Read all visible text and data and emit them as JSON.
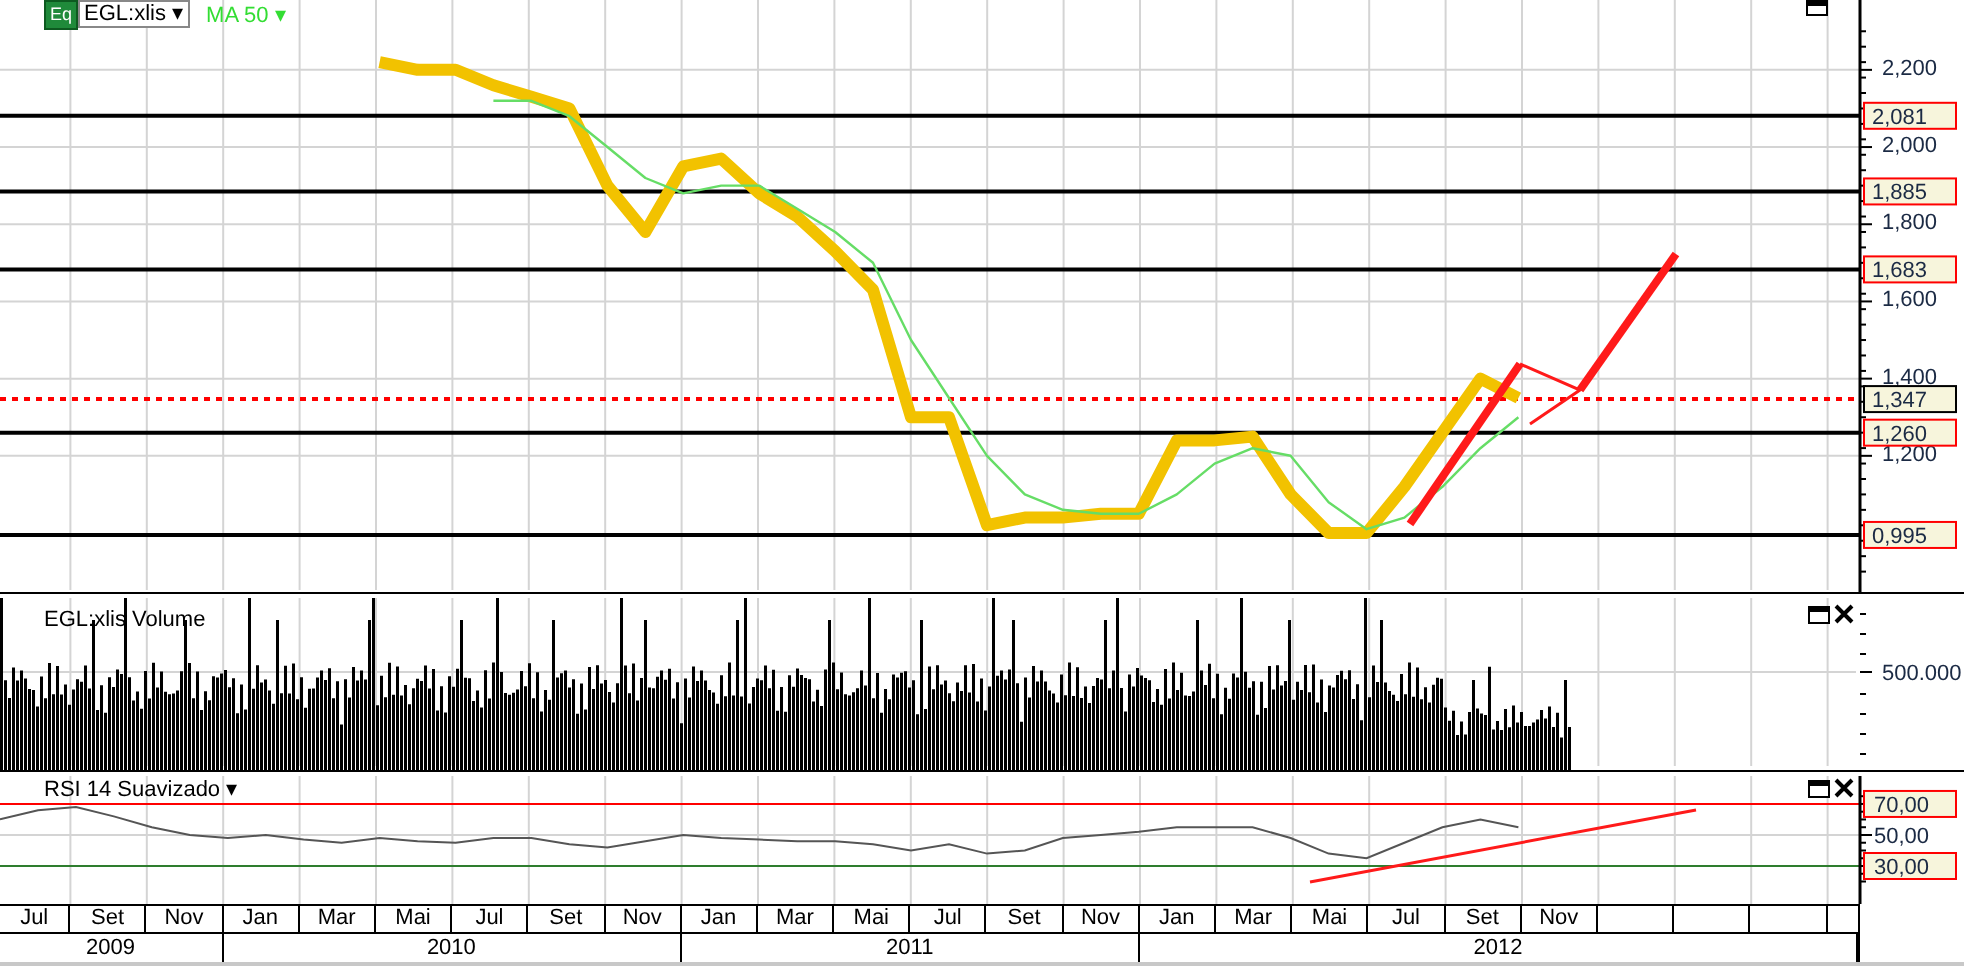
{
  "header": {
    "symbol_badge": "Eq",
    "symbol_caret": "▾",
    "indicator_caret": "▾"
  },
  "price_panel": {
    "chart_data": {
      "type": "line",
      "series": [
        {
          "name": "EGL:xlis",
          "color": "#f2c200",
          "values": [
            null,
            null,
            null,
            null,
            null,
            null,
            null,
            null,
            null,
            null,
            2.22,
            2.2,
            2.2,
            2.16,
            2.13,
            2.1,
            1.9,
            1.78,
            1.95,
            1.97,
            1.88,
            1.82,
            1.73,
            1.63,
            1.3,
            1.3,
            1.02,
            1.04,
            1.04,
            1.05,
            1.05,
            1.24,
            1.24,
            1.25,
            1.1,
            1.0,
            1.0,
            1.12,
            1.26,
            1.4,
            1.35,
            null,
            null,
            null,
            null,
            null,
            null,
            null,
            null,
            null
          ]
        },
        {
          "name": "MA 50",
          "color": "#66dd66",
          "values": [
            null,
            null,
            null,
            null,
            null,
            null,
            null,
            null,
            null,
            null,
            null,
            null,
            null,
            2.12,
            2.12,
            2.08,
            2.0,
            1.92,
            1.88,
            1.9,
            1.9,
            1.84,
            1.78,
            1.7,
            1.5,
            1.35,
            1.2,
            1.1,
            1.06,
            1.05,
            1.05,
            1.1,
            1.18,
            1.22,
            1.2,
            1.08,
            1.01,
            1.04,
            1.12,
            1.22,
            1.3,
            null,
            null,
            null,
            null,
            null,
            null,
            null,
            null,
            null
          ]
        }
      ],
      "ylim": [
        0.842,
        2.381
      ],
      "yticks": [
        {
          "value": 1.2,
          "label": "1,200"
        },
        {
          "value": 1.4,
          "label": "1,400"
        },
        {
          "value": 1.6,
          "label": "1,600"
        },
        {
          "value": 1.8,
          "label": "1,800"
        },
        {
          "value": 2.0,
          "label": "2,000"
        },
        {
          "value": 2.2,
          "label": "2,200"
        }
      ],
      "grid": true,
      "ref_lines": [
        {
          "axis": "y",
          "value": 2.081,
          "label": "2,081",
          "color": "#000000"
        },
        {
          "axis": "y",
          "value": 1.885,
          "label": "1,885",
          "color": "#000000"
        },
        {
          "axis": "y",
          "value": 1.683,
          "label": "1,683",
          "color": "#000000"
        },
        {
          "axis": "y",
          "value": 1.347,
          "label": "1,347",
          "color": "#ff0000"
        },
        {
          "axis": "y",
          "value": 1.26,
          "label": "1,260",
          "color": "#000000"
        },
        {
          "axis": "y",
          "value": 0.995,
          "label": "0,995",
          "color": "#000000"
        }
      ]
    }
  },
  "volume_panel": {
    "title": "EGL:xlis Volume",
    "ytick": "500.000"
  },
  "rsi_panel": {
    "title_caret": "▾",
    "chart_data": {
      "type": "line",
      "series": [
        {
          "name": "RSI 14 Suavizado",
          "color": "#555555",
          "values": [
            60,
            66,
            68,
            62,
            55,
            50,
            48,
            50,
            47,
            45,
            48,
            46,
            45,
            48,
            48,
            44,
            42,
            46,
            50,
            48,
            47,
            46,
            46,
            44,
            40,
            44,
            38,
            40,
            48,
            50,
            52,
            55,
            55,
            55,
            48,
            38,
            35,
            45,
            55,
            60,
            55,
            null,
            null,
            null,
            null,
            null,
            null,
            null,
            null,
            null
          ]
        }
      ],
      "ylim": [
        5.5,
        90.6
      ],
      "yticks": [
        {
          "value": 30,
          "label": "30,00"
        },
        {
          "value": 50,
          "label": "50,00"
        },
        {
          "value": 70,
          "label": "70,00"
        }
      ],
      "grid": true,
      "ref_lines": [
        {
          "axis": "y",
          "value": 70,
          "color": "#ff0000"
        },
        {
          "axis": "y",
          "value": 30,
          "color": "#2e7d2e"
        }
      ]
    }
  },
  "x_axis": {
    "months": [
      "Jul",
      "Set",
      "Nov",
      "Jan",
      "Mar",
      "Mai",
      "Jul",
      "Set",
      "Nov",
      "Jan",
      "Mar",
      "Mai",
      "Jul",
      "Set",
      "Nov",
      "Jan",
      "Mar",
      "Mai",
      "Jul",
      "Set",
      "Nov"
    ],
    "years": [
      "2009",
      "2010",
      "2011",
      "2012"
    ]
  }
}
